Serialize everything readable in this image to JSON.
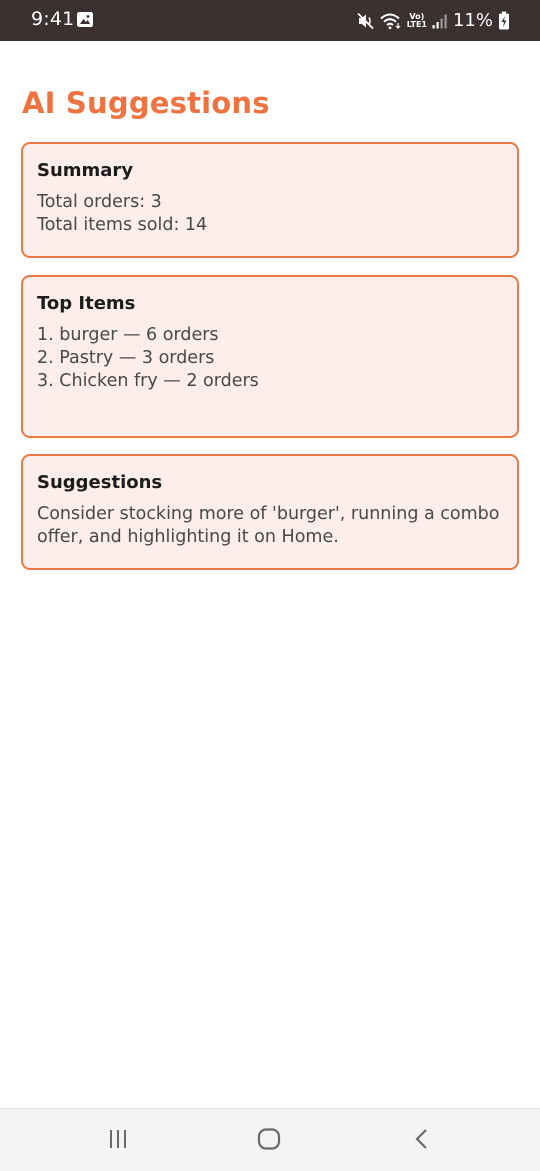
{
  "status_bar": {
    "time": "9:41",
    "battery_percent": "11%",
    "network_label_top": "Vo)",
    "network_label_bottom": "LTE1"
  },
  "page": {
    "title": "AI Suggestions"
  },
  "summary": {
    "heading": "Summary",
    "lines": [
      "Total orders: 3",
      "Total items sold: 14"
    ]
  },
  "top_items": {
    "heading": "Top Items",
    "lines": [
      "1. burger — 6 orders",
      "2. Pastry — 3 orders",
      "3. Chicken fry — 2 orders"
    ]
  },
  "suggestions": {
    "heading": "Suggestions",
    "lines": [
      "Consider stocking more of 'burger', running a combo",
      "offer, and highlighting it on Home."
    ]
  },
  "colors": {
    "accent": "#ef7341",
    "card_background": "#fdeeeb",
    "card_border": "#ec7a45",
    "status_bar": "#3a3130"
  },
  "icons": {
    "status_left": "image-icon",
    "status_right": [
      "mute-icon",
      "wifi-icon",
      "signal-icon",
      "battery-charging-icon"
    ],
    "nav": [
      "recents-icon",
      "home-icon",
      "back-icon"
    ]
  }
}
